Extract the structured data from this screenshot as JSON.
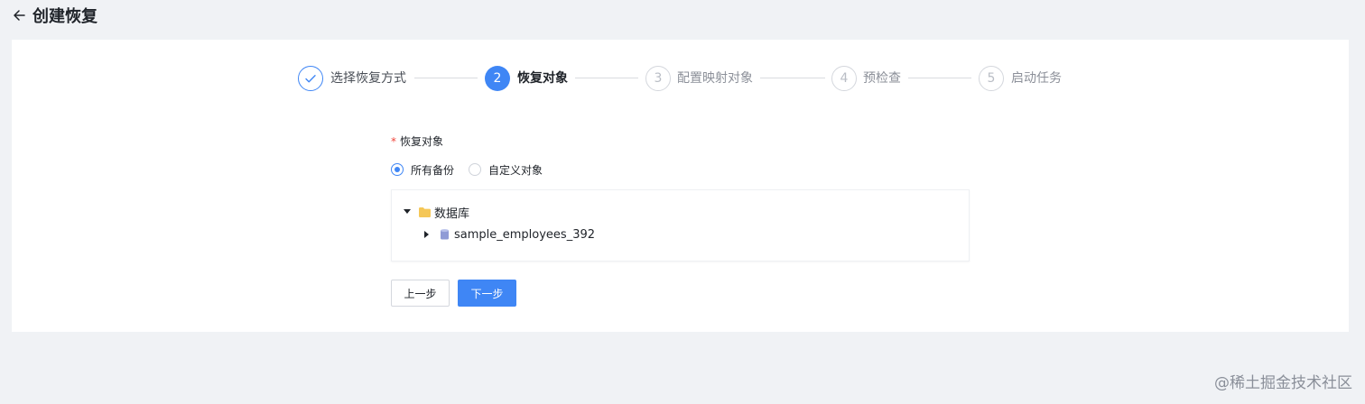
{
  "header": {
    "title": "创建恢复"
  },
  "steps": [
    {
      "number": "1",
      "label": "选择恢复方式",
      "status": "done"
    },
    {
      "number": "2",
      "label": "恢复对象",
      "status": "active"
    },
    {
      "number": "3",
      "label": "配置映射对象",
      "status": "wait"
    },
    {
      "number": "4",
      "label": "预检查",
      "status": "wait"
    },
    {
      "number": "5",
      "label": "启动任务",
      "status": "wait"
    }
  ],
  "form": {
    "required_mark": "*",
    "field_label": "恢复对象",
    "options": [
      {
        "label": "所有备份",
        "checked": true
      },
      {
        "label": "自定义对象",
        "checked": false
      }
    ],
    "tree": {
      "root": {
        "label": "数据库",
        "expanded": true,
        "icon": "folder-icon"
      },
      "child": {
        "label": "sample_employees_392",
        "expanded": false,
        "icon": "database-icon"
      }
    }
  },
  "buttons": {
    "prev": "上一步",
    "next": "下一步"
  },
  "watermark": "@稀土掘金技术社区",
  "colors": {
    "primary": "#3f86f5",
    "background": "#f0f2f5",
    "required": "#f0453b",
    "folder": "#f5c757"
  }
}
